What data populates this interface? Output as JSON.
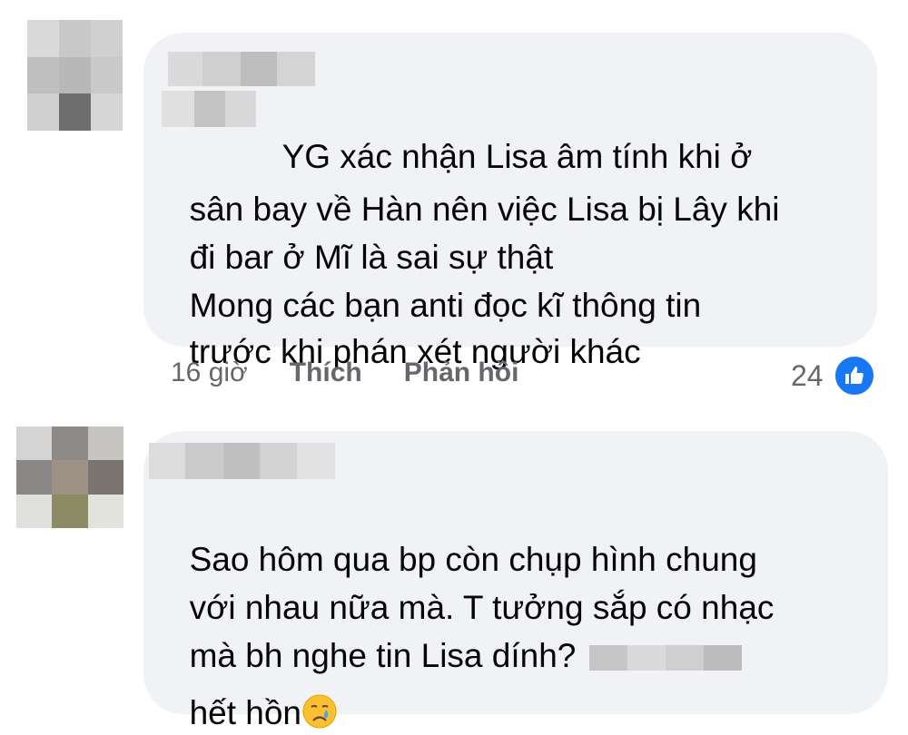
{
  "comments": [
    {
      "text_lines": [
        "YG xác nhận Lisa âm tính khi ở",
        "sân bay về Hàn nên việc Lisa bị Lây khi",
        "đi bar ở Mĩ là sai sự thật",
        "Mong các bạn anti đọc kĩ thông tin",
        "trước khi phán xét người khác"
      ],
      "time": "16 giờ",
      "like_label": "Thích",
      "reply_label": "Phản hồi",
      "reaction_count": "24",
      "reaction_icon": "thumbs-up-icon",
      "avatar_colors": [
        "#d9d9d9",
        "#c8c8c8",
        "#d0d0d0",
        "#bfbfbf",
        "#b8b8b8",
        "#c9c9c9",
        "#cfcfcf",
        "#6e6e6e",
        "#d6d6d6"
      ]
    },
    {
      "text_line1": "Sao hôm qua bp còn chụp hình chung",
      "text_line2": "với nhau nữa mà. T tưởng sắp có nhạc",
      "text_line3_before": "mà bh nghe tin Lisa dính? ",
      "text_line4": "hết hồn",
      "emoji": "crying-face-icon",
      "avatar_colors": [
        "#d4d4d4",
        "#8e8a88",
        "#c7c5c2",
        "#8a8887",
        "#9e9286",
        "#7a7471",
        "#e0e0de",
        "#8c8a63",
        "#e2e3db"
      ]
    }
  ],
  "colors": {
    "bubble": "#f0f2f5",
    "meta_text": "#65676b",
    "like_blue": "#1877f2",
    "text": "#050505"
  }
}
